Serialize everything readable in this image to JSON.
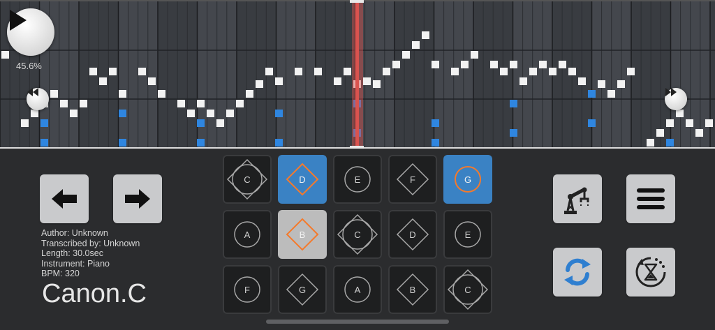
{
  "player": {
    "progress": "45.6%"
  },
  "song": {
    "author": "Author: Unknown",
    "transcriber": "Transcribed by: Unknown",
    "length": "Length: 30.0sec",
    "instrument": "Instrument: Piano",
    "bpm": "BPM: 320",
    "title": "Canon.C"
  },
  "colors": {
    "accent_blue": "#3a82c4",
    "accent_orange": "#f47a2c",
    "playhead": "#d9534f",
    "note_white": "#f2f2f2",
    "note_blue": "#2f86e0"
  },
  "icons": {
    "play": "play-icon",
    "rewind": "rewind-icon",
    "fast_forward": "fast-forward-icon",
    "previous": "arrow-left-icon",
    "next": "arrow-right-icon",
    "robot": "robot-arm-icon",
    "menu": "hamburger-menu-icon",
    "sync": "sync-icon",
    "timer": "hourglass-timer-icon"
  },
  "pads": [
    {
      "label": "C",
      "shape": "diamond-circle",
      "state": "normal"
    },
    {
      "label": "D",
      "shape": "diamond",
      "state": "active"
    },
    {
      "label": "E",
      "shape": "circle",
      "state": "normal"
    },
    {
      "label": "F",
      "shape": "diamond",
      "state": "normal"
    },
    {
      "label": "G",
      "shape": "circle",
      "state": "active"
    },
    {
      "label": "A",
      "shape": "circle",
      "state": "normal"
    },
    {
      "label": "B",
      "shape": "diamond",
      "state": "highlight"
    },
    {
      "label": "C",
      "shape": "diamond-circle",
      "state": "normal"
    },
    {
      "label": "D",
      "shape": "diamond",
      "state": "normal"
    },
    {
      "label": "E",
      "shape": "circle",
      "state": "normal"
    },
    {
      "label": "F",
      "shape": "circle",
      "state": "normal"
    },
    {
      "label": "G",
      "shape": "diamond",
      "state": "normal"
    },
    {
      "label": "A",
      "shape": "circle",
      "state": "normal"
    },
    {
      "label": "B",
      "shape": "diamond",
      "state": "normal"
    },
    {
      "label": "C",
      "shape": "diamond-circle",
      "state": "normal"
    }
  ]
}
